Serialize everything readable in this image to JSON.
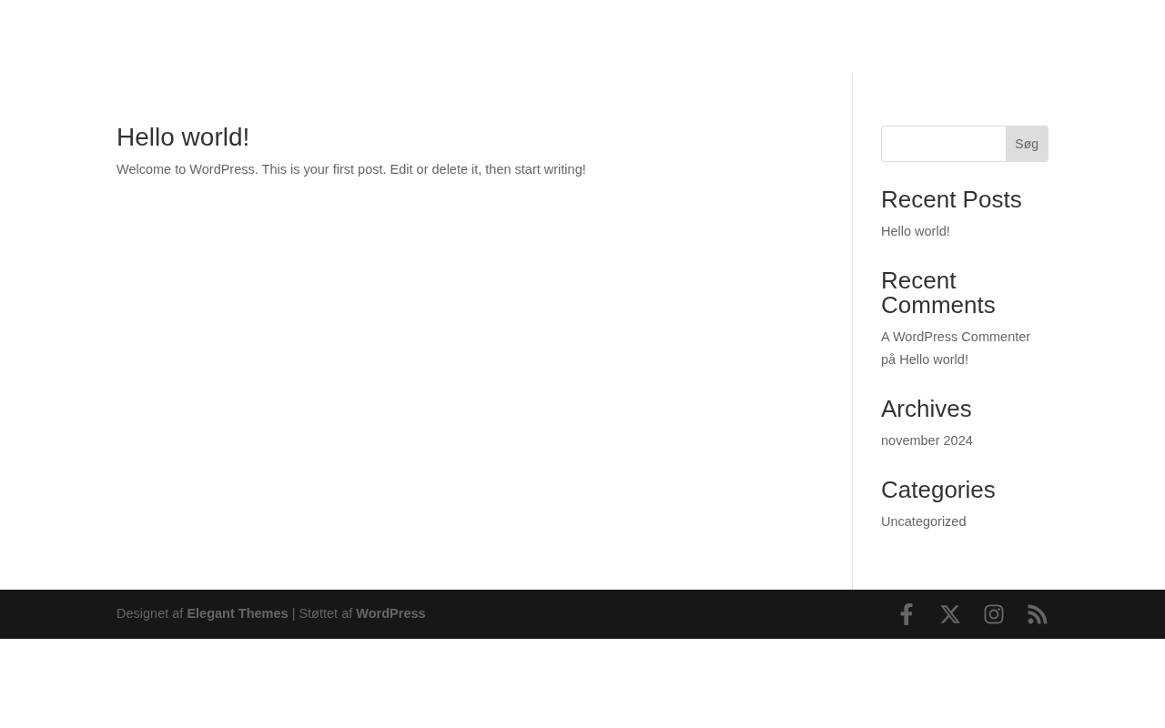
{
  "post": {
    "title": "Hello world!",
    "excerpt": "Welcome to WordPress. This is your first post. Edit or delete it, then start writing!"
  },
  "search": {
    "button": "Søg"
  },
  "widgets": [
    {
      "kind": "links",
      "title": "Recent Posts",
      "items": [
        "Hello world!"
      ]
    },
    {
      "kind": "comments",
      "title": "Recent Comments",
      "author": "A WordPress Commenter",
      "connector": "på",
      "post": "Hello world!"
    },
    {
      "kind": "links",
      "title": "Archives",
      "items": [
        "november 2024"
      ]
    },
    {
      "kind": "links",
      "title": "Categories",
      "items": [
        "Uncategorized"
      ]
    }
  ],
  "footer": {
    "prefix": "Designet af",
    "link1": "Elegant Themes",
    "separator": "| Støttet af",
    "link2": "WordPress",
    "social": [
      {
        "kind": "facebook"
      },
      {
        "kind": "x"
      },
      {
        "kind": "instagram"
      },
      {
        "kind": "rss"
      }
    ]
  }
}
